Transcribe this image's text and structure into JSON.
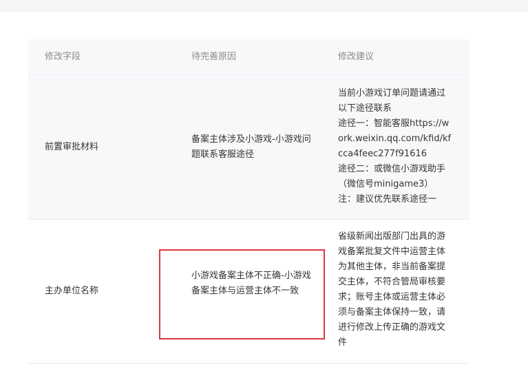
{
  "table": {
    "headers": [
      "修改字段",
      "待完善原因",
      "修改建议"
    ],
    "rows": [
      {
        "field": "前置审批材料",
        "reason": "备案主体涉及小游戏-小游戏问题联系客服途径",
        "suggestion": "当前小游戏订单问题请通过以下途径联系\n途径一：智能客服https://work.weixin.qq.com/kfid/kfcca4feec277f91616\n途径二：或微信小游戏助手（微信号minigame3）\n注：建议优先联系途径一"
      },
      {
        "field": "主办单位名称",
        "reason": "小游戏备案主体不正确-小游戏备案主体与运营主体不一致",
        "suggestion": "省级新闻出版部门出具的游戏备案批复文件中运营主体为其他主体，非当前备案提交主体，不符合管局审核要求；账号主体或运营主体必须与备案主体保持一致，请进行修改上传正确的游戏文件"
      }
    ]
  },
  "colors": {
    "highlight": "#e0343a",
    "header_bg": "#f7f8fa",
    "text": "#353535",
    "header_text": "#8a8a8a"
  }
}
